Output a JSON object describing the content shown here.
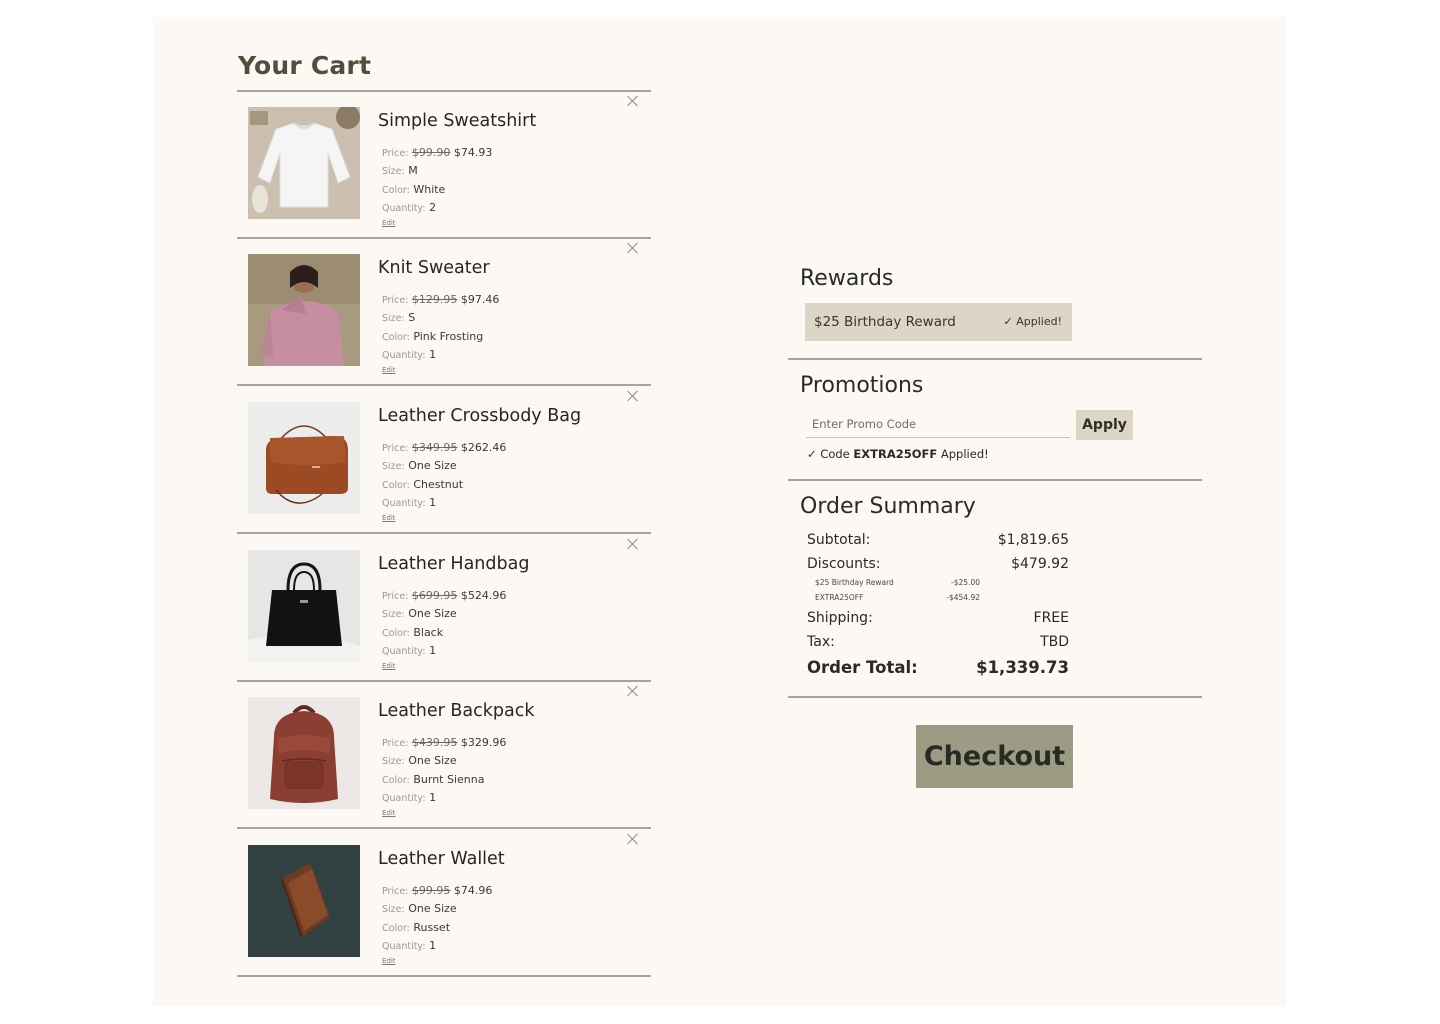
{
  "cart": {
    "title": "Your Cart",
    "labels": {
      "price": "Price:",
      "size": "Size:",
      "color": "Color:",
      "quantity": "Quantity:",
      "edit": "Edit"
    },
    "items": [
      {
        "name": "Simple Sweatshirt",
        "old_price": "$99.90",
        "price": "$74.93",
        "size": "M",
        "color": "White",
        "quantity": "2",
        "image": "white-sweatshirt-photo"
      },
      {
        "name": "Knit Sweater",
        "old_price": "$129.95",
        "price": "$97.46",
        "size": "S",
        "color": "Pink Frosting",
        "quantity": "1",
        "image": "pink-knit-sweater-photo"
      },
      {
        "name": "Leather Crossbody Bag",
        "old_price": "$349.95",
        "price": "$262.46",
        "size": "One Size",
        "color": "Chestnut",
        "quantity": "1",
        "image": "chestnut-crossbody-bag-photo"
      },
      {
        "name": "Leather Handbag",
        "old_price": "$699.95",
        "price": "$524.96",
        "size": "One Size",
        "color": "Black",
        "quantity": "1",
        "image": "black-handbag-photo"
      },
      {
        "name": "Leather Backpack",
        "old_price": "$439.95",
        "price": "$329.96",
        "size": "One Size",
        "color": "Burnt Sienna",
        "quantity": "1",
        "image": "burnt-sienna-backpack-photo"
      },
      {
        "name": "Leather Wallet",
        "old_price": "$99.95",
        "price": "$74.96",
        "size": "One Size",
        "color": "Russet",
        "quantity": "1",
        "image": "russet-wallet-photo"
      }
    ]
  },
  "rewards": {
    "title": "Rewards",
    "reward_label": "$25 Birthday Reward",
    "applied_label": "Applied!"
  },
  "promotions": {
    "title": "Promotions",
    "placeholder": "Enter Promo Code",
    "apply_label": "Apply",
    "code_prefix": "Code",
    "code": "EXTRA25OFF",
    "code_suffix": "Applied!"
  },
  "summary": {
    "title": "Order Summary",
    "subtotal_label": "Subtotal:",
    "subtotal": "$1,819.65",
    "discounts_label": "Discounts:",
    "discounts": "$479.92",
    "discount_lines": [
      {
        "label": "$25 Birthday Reward",
        "amount": "-$25.00"
      },
      {
        "label": "EXTRA25OFF",
        "amount": "-$454.92"
      }
    ],
    "shipping_label": "Shipping:",
    "shipping": "FREE",
    "tax_label": "Tax:",
    "tax": "TBD",
    "total_label": "Order Total:",
    "total": "$1,339.73"
  },
  "checkout_label": "Checkout",
  "colors": {
    "background": "#fcf8f3",
    "rule": "#a9a594",
    "chip": "#ddd6c6",
    "checkout": "#9b9c83",
    "title": "#4f4f3e"
  }
}
